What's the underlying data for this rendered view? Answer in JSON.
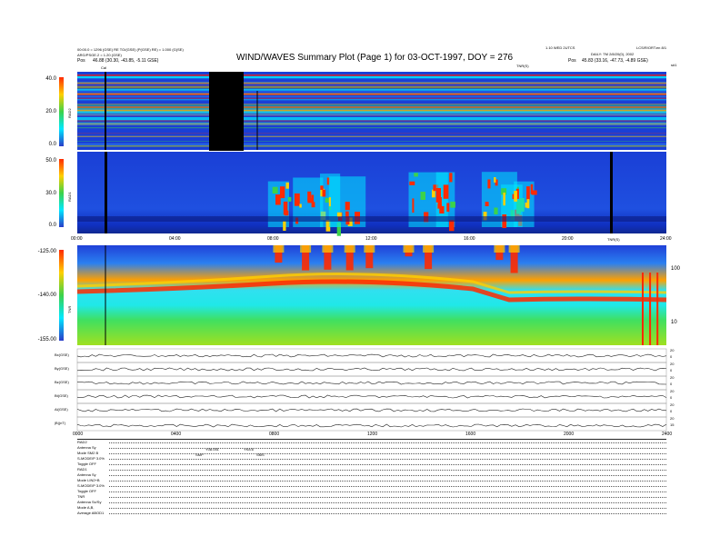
{
  "header": {
    "title": "WIND/WAVES Summary Plot (Page 1) for 03-OCT-1997, DOY = 276",
    "left_line1": "00:00.0 = 1296 (GSE) RE TO/(GSE) (P(GSE) RE) = 1.000 (G(SE)",
    "left_line2": "ARG/PSGE.2 = 1.20 (GSE)",
    "left_pos_label": "Pos",
    "left_pos_value": "46.88 (30.30, -43.85, -5.11 GSE)",
    "right_line1": "1.10 WED 2UTCS",
    "right_line2": "LCS/R/ORT.en 8/1",
    "right_line3": "DAILY: TM 2/8/20(0), 2002",
    "right_pos_label": "Pos",
    "right_pos_value": "45.83 (33.16, -47.73, -4.89 GSE)",
    "tnr_marker": "TNR(S)",
    "corner_label": "s#1",
    "cal_label": "Cal"
  },
  "colors": {
    "background": "#1a3fd6",
    "cbar_top": "#ff2a00",
    "cbar_mid_high": "#ffd000",
    "cbar_mid": "#3cd24a",
    "cbar_mid_low": "#00e8ff",
    "cbar_low": "#2a3cc8"
  },
  "chart_data": [
    {
      "type": "heatmap",
      "panel": "RAD2",
      "label": "RAD2",
      "yticks": [
        "40.0",
        "20.0",
        "0.0"
      ],
      "xlim": [
        0,
        24
      ],
      "data_gap_start_hour": 5.3,
      "data_gap_end_hour": 6.75
    },
    {
      "type": "heatmap",
      "panel": "RAD1",
      "label": "RAD1",
      "yticks": [
        "50.0",
        "30.0",
        "0.0"
      ],
      "xlim": [
        0,
        24
      ],
      "xticks": [
        "00:00",
        "04:00",
        "08:00",
        "12:00",
        "16:00",
        "20:00",
        "24:00"
      ],
      "bursts_hours": [
        8.2,
        9.4,
        10.3,
        11.0,
        14.3,
        15.0,
        17.2,
        17.7,
        18.2
      ]
    },
    {
      "type": "heatmap",
      "panel": "TNR",
      "label": "TNR",
      "yticks": [
        "-125.00",
        "-140.00",
        "-155.00"
      ],
      "right_ticks": [
        "100",
        "10"
      ],
      "xlim": [
        0,
        24
      ]
    },
    {
      "type": "line",
      "panel": "magnetometer",
      "rows": [
        {
          "label": "Bx(GSE)",
          "right": [
            "20",
            "0"
          ]
        },
        {
          "label": "By(GSE)",
          "right": [
            "20",
            "0"
          ]
        },
        {
          "label": "Bz(GSE)",
          "right": [
            "20",
            "0"
          ]
        },
        {
          "label": "Bt(GSE)",
          "right": [
            "20",
            "0"
          ]
        },
        {
          "label": "Al(GSE)",
          "right": [
            "20",
            "0"
          ]
        },
        {
          "label": "|B|(nT)",
          "right": [
            "20",
            "15"
          ]
        }
      ],
      "xticks": [
        "0000",
        "0400",
        "0800",
        "1200",
        "1600",
        "2000",
        "2400"
      ]
    }
  ],
  "footer": {
    "rad2": {
      "label": "RAD2",
      "rows": [
        "Antenna     Sy",
        "Mode        SM2 B",
        "S-MODE/P  3.0%",
        "Toggle      OFF"
      ],
      "notes": [
        "Y08.051",
        "YK8.6",
        "SMP",
        "SMS"
      ]
    },
    "rad1": {
      "label": "RAD1",
      "rows": [
        "Antenna     Sy",
        "Mode       LIN2+B",
        "S-MODE/P  3.0%",
        "Toggle      OFF"
      ]
    },
    "tnr": {
      "label": "TNR",
      "rows": [
        "Antenna   Sx/Sy",
        "Mode        A,B,",
        "Average   ABOD1"
      ]
    }
  }
}
